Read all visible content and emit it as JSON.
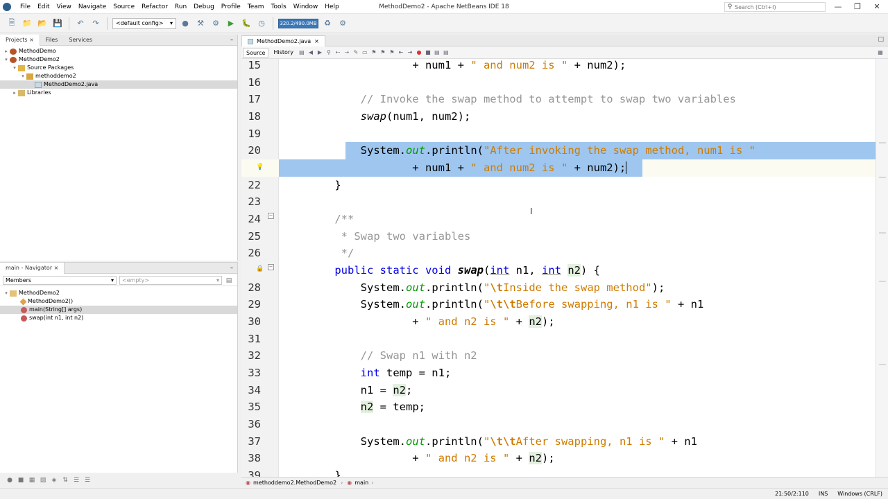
{
  "window": {
    "title": "MethodDemo2 - Apache NetBeans IDE 18"
  },
  "menu": [
    "File",
    "Edit",
    "View",
    "Navigate",
    "Source",
    "Refactor",
    "Run",
    "Debug",
    "Profile",
    "Team",
    "Tools",
    "Window",
    "Help"
  ],
  "search": {
    "placeholder": "Search (Ctrl+I)"
  },
  "toolbar": {
    "config": "<default config>",
    "memory": "320.2/490.0MB"
  },
  "projects_panel": {
    "tabs": [
      "Projects",
      "Files",
      "Services"
    ],
    "tree": [
      {
        "label": "MethodDemo",
        "level": 0,
        "icon": "project-icon"
      },
      {
        "label": "MethodDemo2",
        "level": 0,
        "icon": "project-icon"
      },
      {
        "label": "Source Packages",
        "level": 1,
        "icon": "folder-icon"
      },
      {
        "label": "methoddemo2",
        "level": 2,
        "icon": "package-icon"
      },
      {
        "label": "MethodDemo2.java",
        "level": 3,
        "icon": "java-file-icon",
        "selected": true
      },
      {
        "label": "Libraries",
        "level": 1,
        "icon": "library-icon"
      }
    ]
  },
  "navigator": {
    "title": "main - Navigator",
    "filter": "Members",
    "filter2": "<empty>",
    "items": [
      {
        "label": "MethodDemo2",
        "level": 0,
        "icon": "class-icon"
      },
      {
        "label": "MethodDemo2()",
        "level": 1,
        "icon": "constructor-icon"
      },
      {
        "label": "main(String[] args)",
        "level": 1,
        "icon": "method-icon",
        "selected": true
      },
      {
        "label": "swap(int n1, int n2)",
        "level": 1,
        "icon": "method-icon"
      }
    ]
  },
  "editor": {
    "tab_label": "MethodDemo2.java",
    "source_tab": "Source",
    "history_tab": "History",
    "line_numbers": [
      "15",
      "16",
      "17",
      "18",
      "19",
      "20",
      "",
      "22",
      "23",
      "24",
      "25",
      "26",
      "",
      "28",
      "29",
      "30",
      "31",
      "32",
      "33",
      "34",
      "35",
      "36",
      "37",
      "38",
      "39"
    ]
  },
  "status": {
    "breadcrumb_class": "methoddemo2.MethodDemo2",
    "breadcrumb_method": "main",
    "position": "21:50/2:110",
    "mode": "INS",
    "line_ending": "Windows (CRLF)"
  }
}
